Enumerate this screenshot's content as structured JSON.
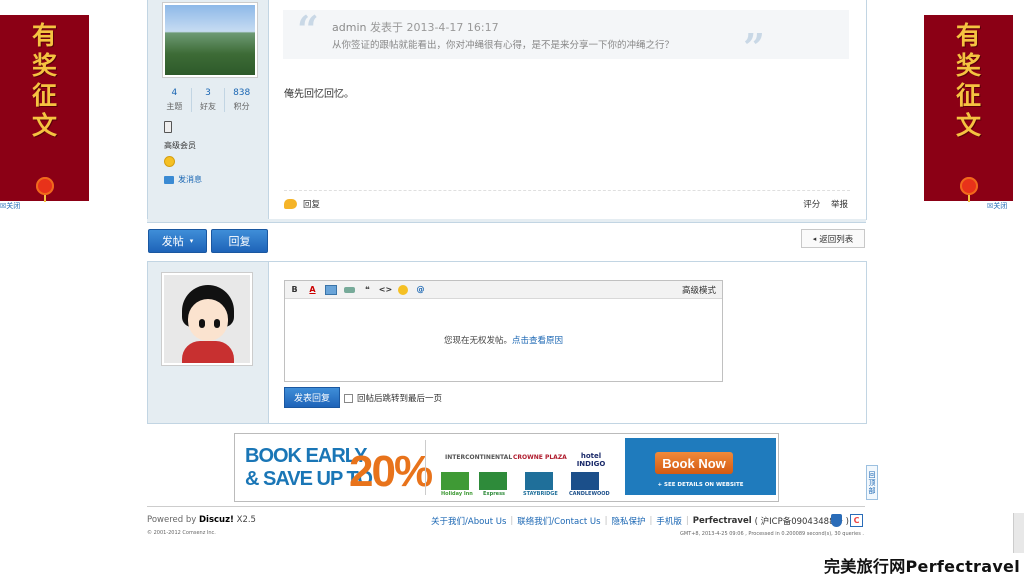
{
  "side_banner": {
    "chars": "有奖征文",
    "close_label": "关闭"
  },
  "post": {
    "stats": [
      {
        "value": "4",
        "label": "主题"
      },
      {
        "value": "3",
        "label": "好友"
      },
      {
        "value": "838",
        "label": "积分"
      }
    ],
    "member_level": "高级会员",
    "send_message": "发消息",
    "quote": {
      "author": "admin",
      "posted_prefix": "发表于",
      "datetime": "2013-4-17 16:17",
      "text": "从你签证的跟帖就能看出，你对冲绳很有心得，是不是来分享一下你的冲绳之行？"
    },
    "body": "俺先回忆回忆。",
    "reply_label": "回复",
    "rate_label": "评分",
    "report_label": "举报"
  },
  "actions": {
    "new_post": "发帖",
    "reply": "回复",
    "back_to_list": "返回列表"
  },
  "reply_box": {
    "advanced_mode": "高级模式",
    "no_permission": "您现在无权发帖。",
    "see_reason": "点击查看原因",
    "submit": "发表回复",
    "jump_label": "回帖后跳转到最后一页"
  },
  "ad": {
    "line1": "BOOK EARLY",
    "line2": "& SAVE UP TO",
    "percent": "20%",
    "logos": [
      "INTERCONTINENTAL",
      "CROWNE PLAZA",
      "hotel INDIGO",
      "Holiday Inn",
      "Express",
      "STAYBRIDGE",
      "CANDLEWOOD"
    ],
    "book_now": "Book Now",
    "see_details": "+ SEE DETAILS ON WEBSITE"
  },
  "back_top": "回顶部",
  "footer": {
    "powered_prefix": "Powered by",
    "brand": "Discuz!",
    "version": "X2.5",
    "copyright": "© 2001-2012 Comsenz Inc.",
    "links": [
      "关于我们/About Us",
      "联络我们/Contact Us",
      "隐私保护",
      "手机版"
    ],
    "site_name": "Perfectravel",
    "icp": "( 沪ICP备09043488号 )",
    "gmt": "GMT+8, 2013-4-25 09:06 , Processed in 0.200089 second(s), 30 queries ."
  },
  "watermark": "完美旅行网Perfectravel"
}
